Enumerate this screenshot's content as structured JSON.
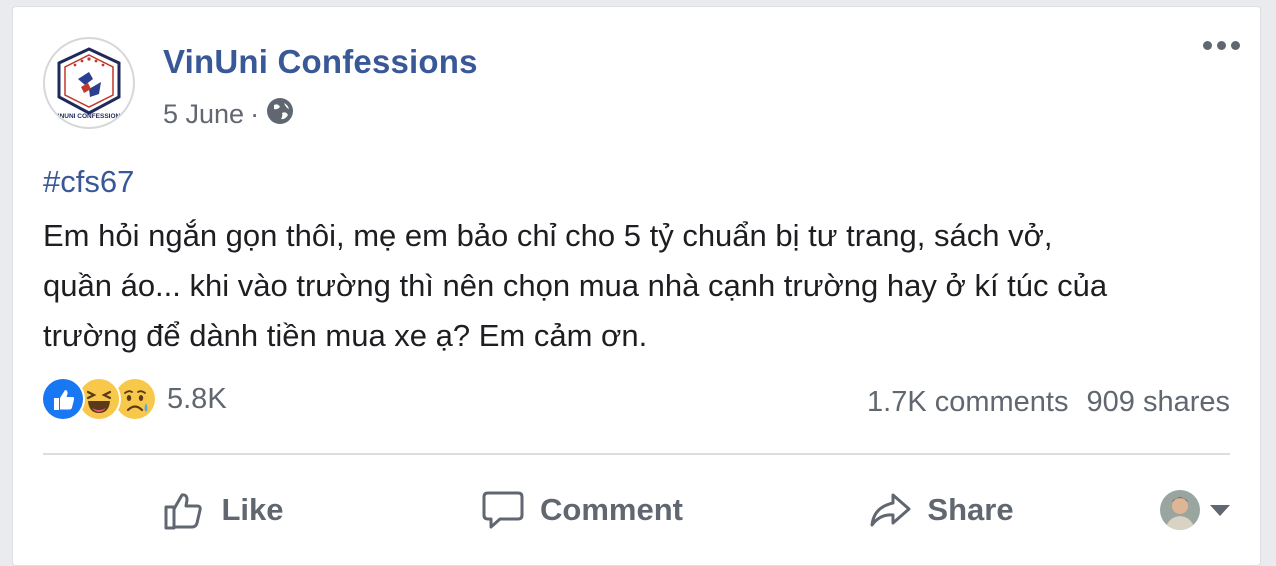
{
  "post": {
    "page_name": "VinUni Confessions",
    "logo_text": "VINUNI CONFESSIONS",
    "date": "5 June",
    "separator": "·",
    "privacy_icon": "globe-icon",
    "more_icon": "more-options-icon",
    "hashtag": "#cfs67",
    "text": "Em hỏi ngắn gọn thôi, mẹ em bảo chỉ cho 5 tỷ chuẩn bị tư trang, sách vở,\nquần áo... khi vào trường thì nên chọn mua nhà cạnh trường hay ở kí túc của\ntrường để dành tiền mua xe ạ? Em cảm ơn."
  },
  "reactions": {
    "icons": [
      "like-reaction-icon",
      "haha-reaction-icon",
      "sad-reaction-icon"
    ],
    "count": "5.8K"
  },
  "stats": {
    "comments": "1.7K comments",
    "shares": "909 shares"
  },
  "actions": {
    "like": "Like",
    "comment": "Comment",
    "share": "Share"
  },
  "colors": {
    "link": "#385898",
    "text": "#1c1e21",
    "muted": "#606770",
    "like_blue": "#1877f2",
    "emoji_yellow": "#f7c84a",
    "background": "#e9ebee"
  }
}
